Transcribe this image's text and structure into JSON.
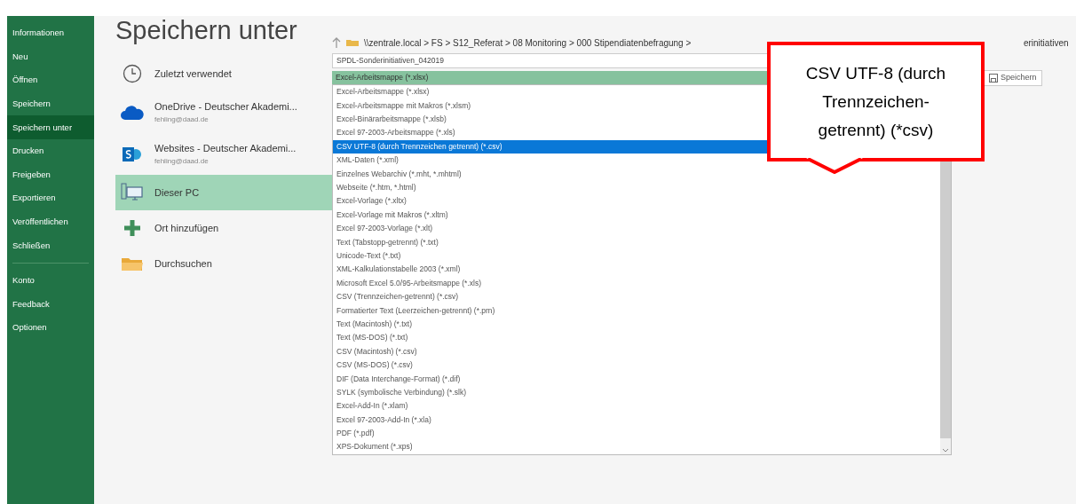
{
  "sidebar": {
    "items": [
      {
        "label": "Informationen",
        "selected": false
      },
      {
        "label": "Neu",
        "selected": false
      },
      {
        "label": "Öffnen",
        "selected": false
      },
      {
        "label": "Speichern",
        "selected": false
      },
      {
        "label": "Speichern unter",
        "selected": true
      },
      {
        "label": "Drucken",
        "selected": false
      },
      {
        "label": "Freigeben",
        "selected": false
      },
      {
        "label": "Exportieren",
        "selected": false
      },
      {
        "label": "Veröffentlichen",
        "selected": false
      },
      {
        "label": "Schließen",
        "selected": false
      }
    ],
    "bottom_items": [
      {
        "label": "Konto",
        "selected": false
      },
      {
        "label": "Feedback",
        "selected": false
      },
      {
        "label": "Optionen",
        "selected": false
      }
    ]
  },
  "title": "Speichern unter",
  "places": [
    {
      "kind": "clock",
      "label": "Zuletzt verwendet",
      "selected": false
    },
    {
      "kind": "cloud",
      "label": "OneDrive - Deutscher Akademi...",
      "sublabel": "fehling@daad.de",
      "selected": false
    },
    {
      "kind": "sharepoint",
      "label": "Websites - Deutscher Akademi...",
      "sublabel": "fehling@daad.de",
      "selected": false
    },
    {
      "kind": "pc",
      "label": "Dieser PC",
      "selected": true
    },
    {
      "kind": "plus",
      "label": "Ort hinzufügen",
      "selected": false
    },
    {
      "kind": "folder",
      "label": "Durchsuchen",
      "selected": false
    }
  ],
  "path": "\\\\zentrale.local > FS > S12_Referat > 08 Monitoring > 000 Stipendiatenbefragung >",
  "path_tail": "erinitiativen",
  "filename": "SPDL-Sonderinitiativen_042019",
  "file_type": "Excel-Arbeitsmappe (*.xlsx)",
  "file_type_options": [
    {
      "label": "Excel-Arbeitsmappe (*.xlsx)",
      "selected": false
    },
    {
      "label": "Excel-Arbeitsmappe mit Makros (*.xlsm)",
      "selected": false
    },
    {
      "label": "Excel-Binärarbeitsmappe (*.xlsb)",
      "selected": false
    },
    {
      "label": "Excel 97-2003-Arbeitsmappe (*.xls)",
      "selected": false
    },
    {
      "label": "CSV UTF-8 (durch Trennzeichen getrennt) (*.csv)",
      "selected": true
    },
    {
      "label": "XML-Daten (*.xml)",
      "selected": false
    },
    {
      "label": "Einzelnes Webarchiv (*.mht, *.mhtml)",
      "selected": false
    },
    {
      "label": "Webseite (*.htm, *.html)",
      "selected": false
    },
    {
      "label": "Excel-Vorlage (*.xltx)",
      "selected": false
    },
    {
      "label": "Excel-Vorlage mit Makros (*.xltm)",
      "selected": false
    },
    {
      "label": "Excel 97-2003-Vorlage (*.xlt)",
      "selected": false
    },
    {
      "label": "Text (Tabstopp-getrennt) (*.txt)",
      "selected": false
    },
    {
      "label": "Unicode-Text (*.txt)",
      "selected": false
    },
    {
      "label": "XML-Kalkulationstabelle 2003 (*.xml)",
      "selected": false
    },
    {
      "label": "Microsoft Excel 5.0/95-Arbeitsmappe (*.xls)",
      "selected": false
    },
    {
      "label": "CSV (Trennzeichen-getrennt) (*.csv)",
      "selected": false
    },
    {
      "label": "Formatierter Text (Leerzeichen-getrennt) (*.prn)",
      "selected": false
    },
    {
      "label": "Text (Macintosh) (*.txt)",
      "selected": false
    },
    {
      "label": "Text (MS-DOS) (*.txt)",
      "selected": false
    },
    {
      "label": "CSV (Macintosh) (*.csv)",
      "selected": false
    },
    {
      "label": "CSV (MS-DOS) (*.csv)",
      "selected": false
    },
    {
      "label": "DIF (Data Interchange-Format) (*.dif)",
      "selected": false
    },
    {
      "label": "SYLK (symbolische Verbindung) (*.slk)",
      "selected": false
    },
    {
      "label": "Excel-Add-In (*.xlam)",
      "selected": false
    },
    {
      "label": "Excel 97-2003-Add-In (*.xla)",
      "selected": false
    },
    {
      "label": "PDF (*.pdf)",
      "selected": false
    },
    {
      "label": "XPS-Dokument (*.xps)",
      "selected": false
    }
  ],
  "save_button": "Speichern",
  "callout": "CSV UTF-8 (durch Trennzeichen-getrennt) (*csv)"
}
